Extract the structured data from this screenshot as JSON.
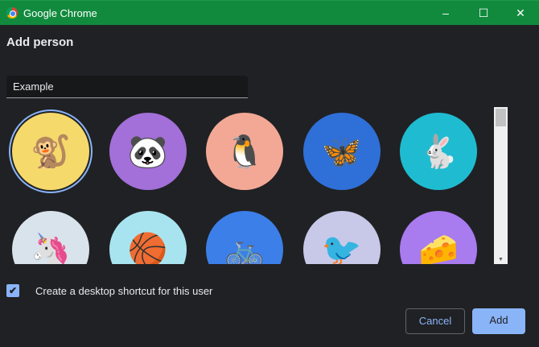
{
  "window": {
    "title": "Google Chrome",
    "minimize": "–",
    "maximize": "☐",
    "close": "✕"
  },
  "dialog": {
    "heading": "Add person",
    "name_value": "Example"
  },
  "avatars": [
    {
      "name": "monkey",
      "icon": "🐒",
      "bg": "#f5d96b",
      "selected": true
    },
    {
      "name": "panda",
      "icon": "🐼",
      "bg": "#a36fd8"
    },
    {
      "name": "penguin",
      "icon": "🐧",
      "bg": "#f3a896"
    },
    {
      "name": "butterfly",
      "icon": "🦋",
      "bg": "#2f6fd8"
    },
    {
      "name": "rabbit",
      "icon": "🐇",
      "bg": "#1fbcd1"
    },
    {
      "name": "unicorn",
      "icon": "🦄",
      "bg": "#d9e3ec"
    },
    {
      "name": "basketball",
      "icon": "🏀",
      "bg": "#a8e4f0"
    },
    {
      "name": "bicycle",
      "icon": "🚲",
      "bg": "#3c7fe8"
    },
    {
      "name": "bird",
      "icon": "🐦",
      "bg": "#c8c8e8"
    },
    {
      "name": "cheese",
      "icon": "🧀",
      "bg": "#a87bef"
    }
  ],
  "shortcut": {
    "label": "Create a desktop shortcut for this user",
    "checked": true,
    "check": "✔"
  },
  "buttons": {
    "cancel": "Cancel",
    "add": "Add"
  },
  "scrollbar": {
    "down": "▼"
  }
}
